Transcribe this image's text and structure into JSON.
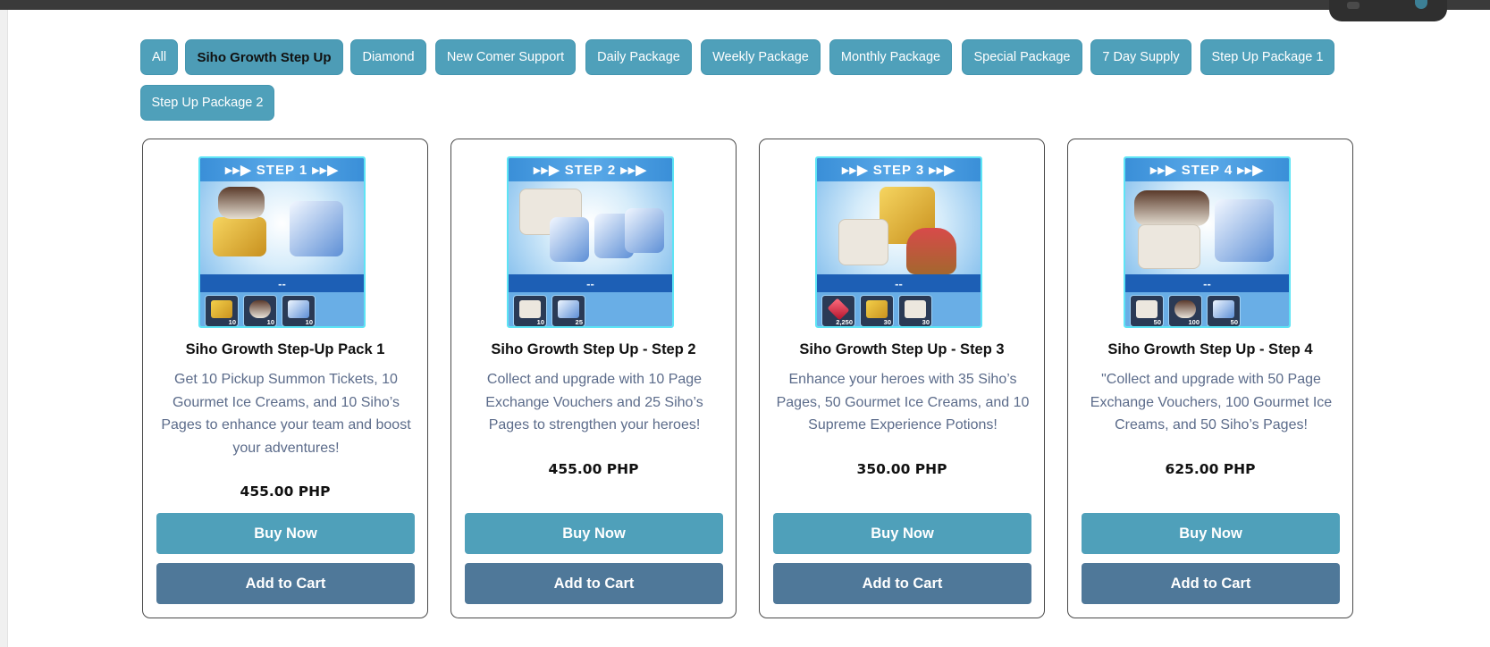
{
  "filters": [
    {
      "label": "All",
      "active": false
    },
    {
      "label": "Siho Growth Step Up",
      "active": true
    },
    {
      "label": "Diamond",
      "active": false
    },
    {
      "label": "New Comer Support",
      "active": false
    },
    {
      "label": "Daily Package",
      "active": false
    },
    {
      "label": "Weekly Package",
      "active": false
    },
    {
      "label": "Monthly Package",
      "active": false
    },
    {
      "label": "Special Package",
      "active": false
    },
    {
      "label": "7 Day Supply",
      "active": false
    },
    {
      "label": "Step Up Package 1",
      "active": false
    },
    {
      "label": "Step Up Package 2",
      "active": false
    }
  ],
  "products": [
    {
      "banner": "▸▸▶ STEP 1 ▸▸▶",
      "strip": "--",
      "items": [
        {
          "icon": "summon-ticket-icon",
          "qty": "10"
        },
        {
          "icon": "ice-cream-icon",
          "qty": "10"
        },
        {
          "icon": "siho-page-icon",
          "qty": "10"
        }
      ],
      "title": "Siho Growth Step-Up Pack 1",
      "description": "Get 10 Pickup Summon Tickets, 10 Gourmet Ice Creams, and 10 Siho’s Pages to enhance your team and boost your adventures!",
      "price": "455.00 PHP",
      "buy_label": "Buy Now",
      "cart_label": "Add to Cart"
    },
    {
      "banner": "▸▸▶ STEP 2 ▸▸▶",
      "strip": "--",
      "items": [
        {
          "icon": "exchange-voucher-icon",
          "qty": "10"
        },
        {
          "icon": "siho-page-icon",
          "qty": "25"
        }
      ],
      "title": "Siho Growth Step Up - Step 2",
      "description": "Collect and upgrade with 10 Page Exchange Vouchers and 25 Siho’s Pages to strengthen your heroes!",
      "price": "455.00 PHP",
      "buy_label": "Buy Now",
      "cart_label": "Add to Cart"
    },
    {
      "banner": "▸▸▶ STEP 3 ▸▸▶",
      "strip": "--",
      "items": [
        {
          "icon": "gem-icon",
          "qty": "2,250"
        },
        {
          "icon": "summon-ticket-icon",
          "qty": "30"
        },
        {
          "icon": "exchange-voucher-icon",
          "qty": "30"
        }
      ],
      "title": "Siho Growth Step Up - Step 3",
      "description": "Enhance your heroes with 35 Siho’s Pages, 50 Gourmet Ice Creams, and 10 Supreme Experience Potions!",
      "price": "350.00 PHP",
      "buy_label": "Buy Now",
      "cart_label": "Add to Cart"
    },
    {
      "banner": "▸▸▶ STEP 4 ▸▸▶",
      "strip": "--",
      "items": [
        {
          "icon": "exchange-voucher-icon",
          "qty": "50"
        },
        {
          "icon": "ice-cream-icon",
          "qty": "100"
        },
        {
          "icon": "siho-page-icon",
          "qty": "50"
        }
      ],
      "title": "Siho Growth Step Up - Step 4",
      "description": "\"Collect and upgrade with 50 Page Exchange Vouchers, 100 Gourmet Ice Creams, and 50 Siho’s Pages!",
      "price": "625.00 PHP",
      "buy_label": "Buy Now",
      "cart_label": "Add to Cart"
    }
  ],
  "colors": {
    "chip_bg": "#4fa0ba",
    "buy_bg": "#4fa0ba",
    "cart_bg": "#4f7899",
    "description_text": "#5b6b8a"
  }
}
